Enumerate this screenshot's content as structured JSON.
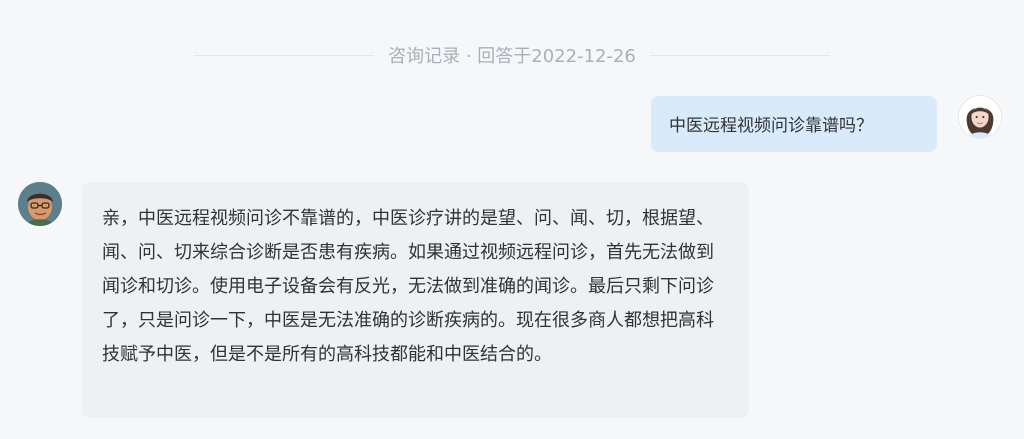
{
  "conversation": {
    "header": "咨询记录 · 回答于2022-12-26",
    "messages": [
      {
        "role": "user",
        "avatar": "user-avatar",
        "text": "中医远程视频问诊靠谱吗？"
      },
      {
        "role": "doctor",
        "avatar": "doctor-avatar",
        "text": "亲，中医远程视频问诊不靠谱的，中医诊疗讲的是望、问、闻、切，根据望、闻、问、切来综合诊断是否患有疾病。如果通过视频远程问诊，首先无法做到闻诊和切诊。使用电子设备会有反光，无法做到准确的闻诊。最后只剩下问诊了，只是问诊一下，中医是无法准确的诊断疾病的。现在很多商人都想把高科技赋予中医，但是不是所有的高科技都能和中医结合的。"
      }
    ]
  }
}
